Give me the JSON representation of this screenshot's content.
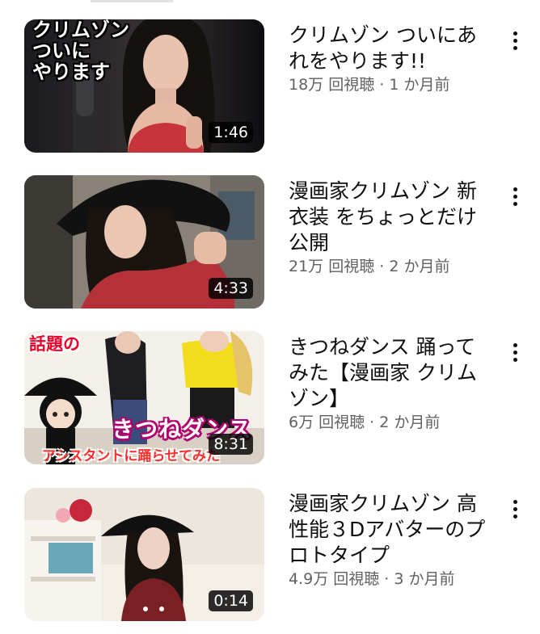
{
  "videos": [
    {
      "title": "クリムゾン ついにあれをやります!!",
      "meta": "18万 回視聴 · 1 か月前",
      "duration": "1:46",
      "thumb_caption": "クリムゾン\nついに\nやります"
    },
    {
      "title": "漫画家クリムゾン 新衣装 をちょっとだけ公開",
      "meta": "21万 回視聴 · 2 か月前",
      "duration": "4:33"
    },
    {
      "title": "きつねダンス 踊ってみた【漫画家 クリムゾン】",
      "meta": "6万 回視聴 · 2 か月前",
      "duration": "8:31",
      "thumb_tag": "話題の",
      "thumb_title": "きつねダンス",
      "thumb_sub": "アシスタントに踊らせてみた"
    },
    {
      "title": "漫画家クリムゾン 高性能３Dアバターのプロトタイプ",
      "meta": "4.9万 回視聴 · 3 か月前",
      "duration": "0:14"
    }
  ],
  "icons": {
    "more": "more-vert-icon"
  },
  "colors": {
    "title": "#0f0f0f",
    "meta": "#606060",
    "duration_bg": "#000000"
  }
}
